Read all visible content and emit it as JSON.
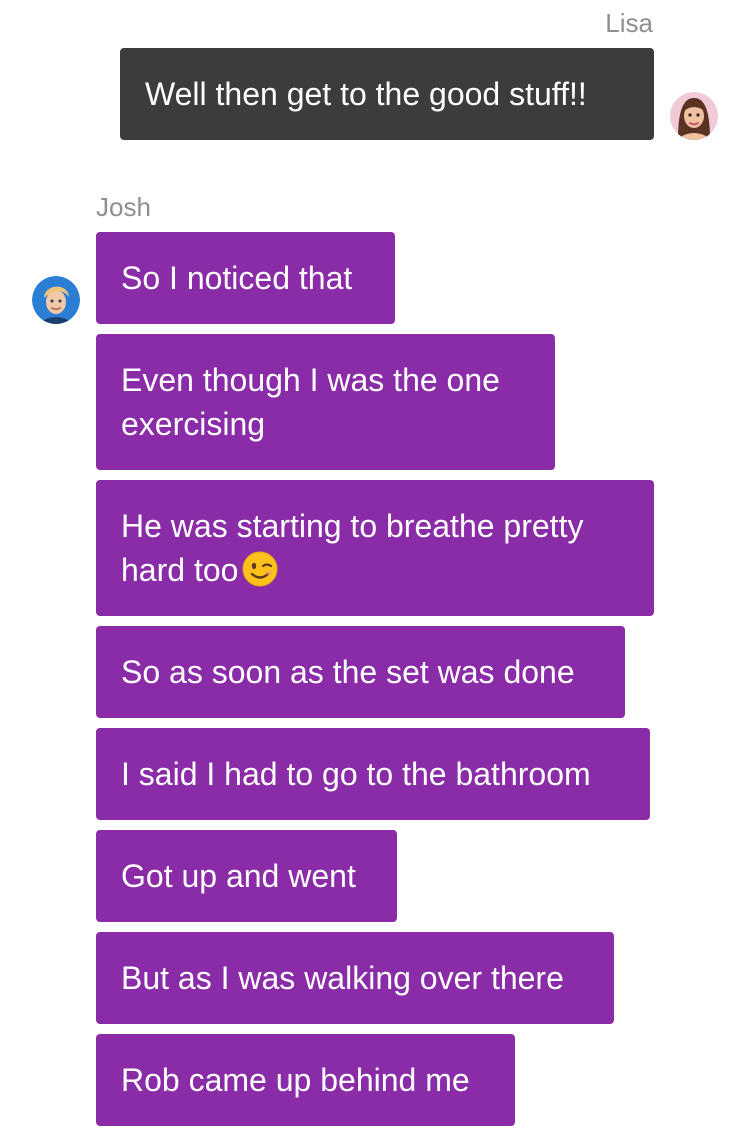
{
  "colors": {
    "lisa_bubble": "#3c3c3c",
    "josh_bubble": "#8a2ba8",
    "sender_name": "#8e8e93",
    "background": "#ffffff"
  },
  "messages": [
    {
      "sender": "Lisa",
      "avatar_icon": "lisa-avatar-icon",
      "bubbles": [
        {
          "lines": [
            "Well then get to the good stuff!!"
          ]
        }
      ]
    },
    {
      "sender": "Josh",
      "avatar_icon": "josh-avatar-icon",
      "bubbles": [
        {
          "lines": [
            "So I noticed that"
          ]
        },
        {
          "lines": [
            "Even though I was the one",
            "exercising"
          ]
        },
        {
          "lines": [
            "He was starting to breathe pretty",
            "hard too"
          ],
          "emoji": "winking-face-emoji"
        },
        {
          "lines": [
            "So as soon as the set was done"
          ]
        },
        {
          "lines": [
            "I said I had to go to the bathroom"
          ]
        },
        {
          "lines": [
            "Got up and went"
          ]
        },
        {
          "lines": [
            "But as I was walking over there"
          ]
        },
        {
          "lines": [
            "Rob came up behind me"
          ]
        }
      ]
    }
  ]
}
